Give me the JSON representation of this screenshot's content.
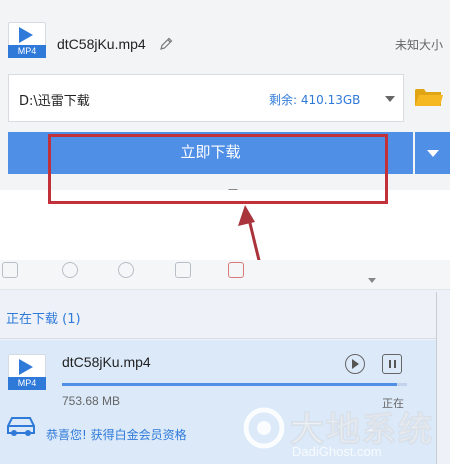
{
  "dialog": {
    "file_icon_tag": "MP4",
    "file_name": "dtC58jKu.mp4",
    "file_size": "未知大小",
    "save_path": "D:\\迅雷下载",
    "free_space": "剩余: 410.13GB",
    "download_now_label": "立即下载"
  },
  "task_list": {
    "section_title": "正在下载 (1)",
    "task": {
      "icon_tag": "MP4",
      "name": "dtC58jKu.mp4",
      "size": "753.68 MB",
      "status": "正在",
      "progress": 0.97
    },
    "vip_prompt": "恭喜您! 获得白金会员资格"
  },
  "watermark": {
    "title": "大地系统",
    "url": "DadiGhost.com"
  },
  "colors": {
    "accent": "#4f8fe6",
    "link": "#2f7ad9",
    "highlight": "#c2303a",
    "folder": "#f5b722"
  }
}
